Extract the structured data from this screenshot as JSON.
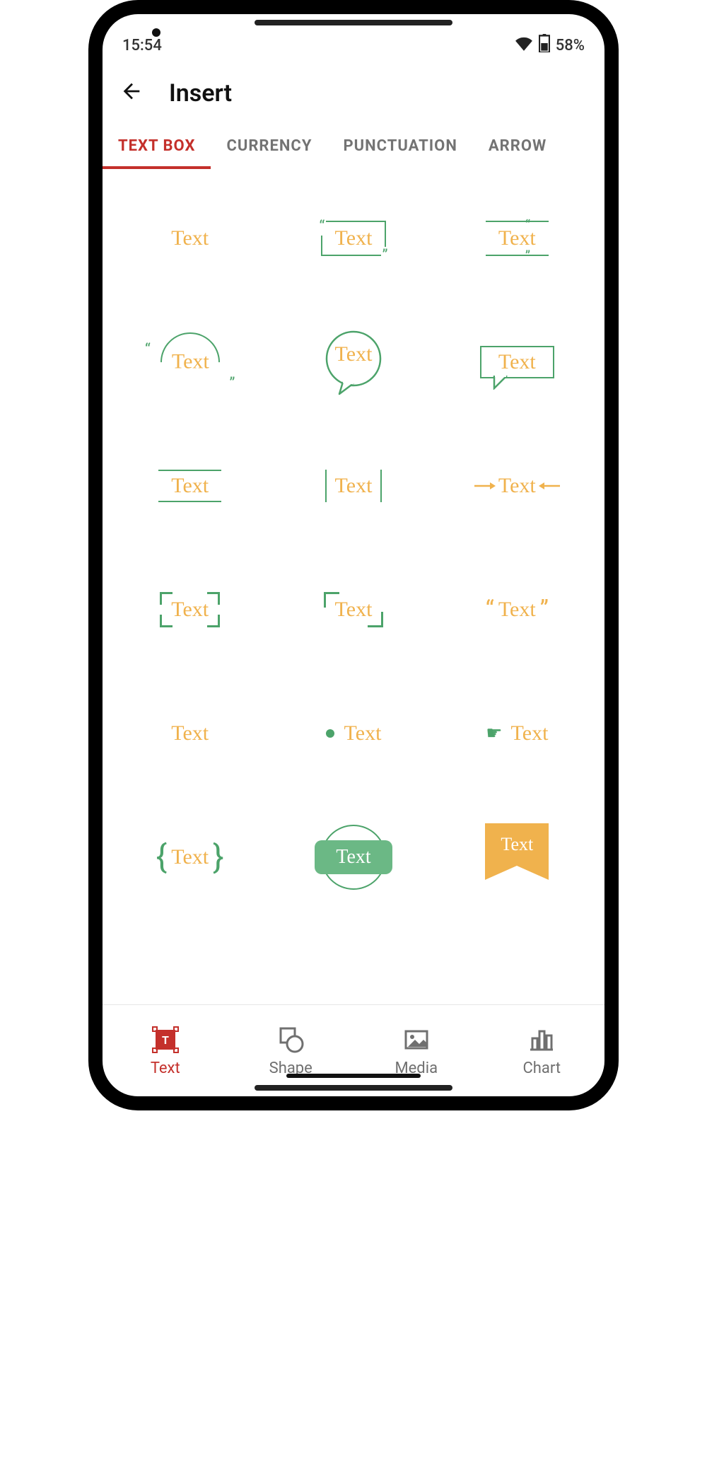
{
  "status": {
    "time": "15:54",
    "battery_pct": "58%"
  },
  "header": {
    "title": "Insert"
  },
  "tabs": [
    {
      "label": "TEXT BOX",
      "active": true
    },
    {
      "label": "CURRENCY",
      "active": false
    },
    {
      "label": "PUNCTUATION",
      "active": false
    },
    {
      "label": "ARROW",
      "active": false
    }
  ],
  "placeholder_text": "Text",
  "text_box_styles": [
    {
      "id": "plain"
    },
    {
      "id": "rect-quotes"
    },
    {
      "id": "rules-quotes"
    },
    {
      "id": "circle-quotes"
    },
    {
      "id": "speech-circle"
    },
    {
      "id": "speech-rect"
    },
    {
      "id": "top-bottom-rule"
    },
    {
      "id": "side-rules"
    },
    {
      "id": "arrow-rules"
    },
    {
      "id": "brackets-corners"
    },
    {
      "id": "corners-tl-br"
    },
    {
      "id": "double-quotes"
    },
    {
      "id": "plain-2"
    },
    {
      "id": "bullet"
    },
    {
      "id": "hand-pointer"
    },
    {
      "id": "curly-braces"
    },
    {
      "id": "pill-circle"
    },
    {
      "id": "ribbon"
    }
  ],
  "bottom_nav": [
    {
      "label": "Text",
      "icon": "text",
      "active": true
    },
    {
      "label": "Shape",
      "icon": "shape",
      "active": false
    },
    {
      "label": "Media",
      "icon": "media",
      "active": false
    },
    {
      "label": "Chart",
      "icon": "chart",
      "active": false
    }
  ]
}
